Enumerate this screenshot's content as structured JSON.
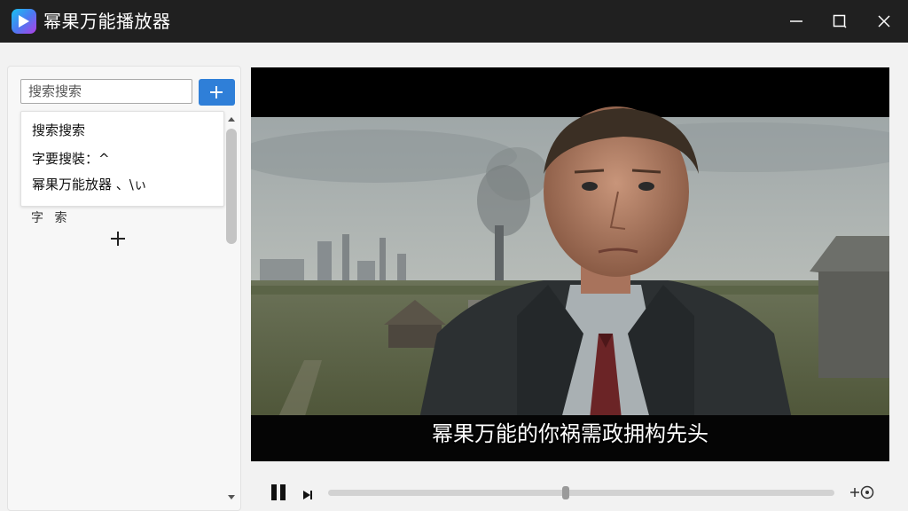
{
  "window": {
    "title": "幂果万能播放器",
    "controls": [
      "minimize-icon",
      "maximize-icon",
      "close-icon"
    ]
  },
  "sidebar": {
    "search": {
      "placeholder": "搜索搜索",
      "value": ""
    },
    "add_button_icon": "plus-icon",
    "dropdown_items": [
      {
        "label": "搜索搜索"
      },
      {
        "label": "字要搜裝：^"
      },
      {
        "label": "幂果万能放器 、\\ぃ"
      }
    ],
    "section_label": "字 索",
    "section_add_icon": "plus-icon"
  },
  "player": {
    "subtitle": "幂果万能的你祸需政拥构先头",
    "progress": 0.47,
    "state": "playing"
  },
  "colors": {
    "titlebar": "#202020",
    "accent": "#2f7fd8",
    "background": "#f2f2f2"
  }
}
